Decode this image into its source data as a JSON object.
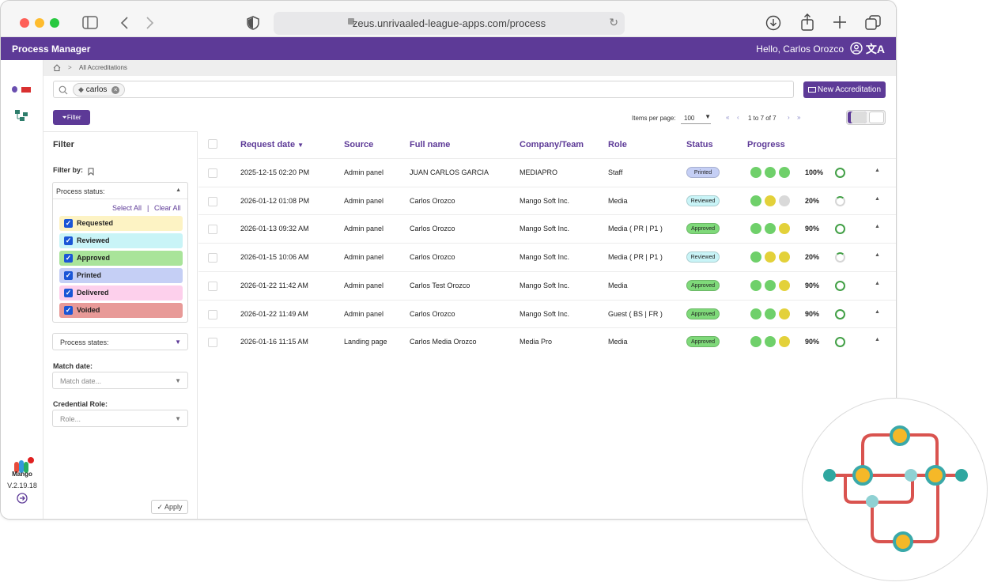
{
  "browser": {
    "url": "zeus.unrivaaled-league-apps.com/process"
  },
  "app": {
    "title": "Process Manager",
    "greeting": "Hello, Carlos Orozco"
  },
  "breadcrumb": {
    "current": "All Accreditations"
  },
  "search": {
    "chip": "carlos"
  },
  "toolbar": {
    "new_button": "New Accreditation",
    "filter_button": "Filter"
  },
  "pager": {
    "items_per_page_label": "Items per page:",
    "items_per_page": "100",
    "range": "1 to 7 of 7"
  },
  "sidebar": {
    "brand": "Mango",
    "version": "V.2.19.18"
  },
  "filter": {
    "title": "Filter",
    "filter_by": "Filter by:",
    "process_status_label": "Process status:",
    "select_all": "Select All",
    "separator": "|",
    "clear_all": "Clear All",
    "statuses": [
      {
        "label": "Requested",
        "color": "#fdf3c4"
      },
      {
        "label": "Reviewed",
        "color": "#c9f4f7"
      },
      {
        "label": "Approved",
        "color": "#a9e49a"
      },
      {
        "label": "Printed",
        "color": "#c5cff5"
      },
      {
        "label": "Delivered",
        "color": "#fdd0ec"
      },
      {
        "label": "Voided",
        "color": "#e89a98"
      }
    ],
    "process_states_label": "Process states:",
    "match_date_label": "Match date:",
    "match_date_placeholder": "Match date...",
    "credential_role_label": "Credential Role:",
    "role_placeholder": "Role...",
    "apply": "Apply"
  },
  "table": {
    "headers": {
      "request_date": "Request date",
      "source": "Source",
      "full_name": "Full name",
      "company": "Company/Team",
      "role": "Role",
      "status": "Status",
      "progress": "Progress"
    },
    "rows": [
      {
        "date": "2025-12-15 02:20 PM",
        "source": "Admin panel",
        "name": "JUAN CARLOS GARCIA",
        "company": "MEDIAPRO",
        "role": "Staff",
        "status": "Printed",
        "status_color": "#c5cff5",
        "dots": [
          "#6fd06a",
          "#6fd06a",
          "#6fd06a"
        ],
        "progress": "100%",
        "progress_value": 100
      },
      {
        "date": "2026-01-12 01:08 PM",
        "source": "Admin panel",
        "name": "Carlos Orozco",
        "company": "Mango Soft Inc.",
        "role": "Media",
        "status": "Reviewed",
        "status_color": "#c9f4f7",
        "dots": [
          "#6fd06a",
          "#e3d13a",
          "#d9d9d9"
        ],
        "progress": "20%",
        "progress_value": 20
      },
      {
        "date": "2026-01-13 09:32 AM",
        "source": "Admin panel",
        "name": "Carlos Orozco",
        "company": "Mango Soft Inc.",
        "role": "Media ( PR | P1 )",
        "status": "Approved",
        "status_color": "#7fd97a",
        "dots": [
          "#6fd06a",
          "#6fd06a",
          "#e3d13a"
        ],
        "progress": "90%",
        "progress_value": 90
      },
      {
        "date": "2026-01-15 10:06 AM",
        "source": "Admin panel",
        "name": "Carlos Orozco",
        "company": "Mango Soft Inc.",
        "role": "Media ( PR | P1 )",
        "status": "Reviewed",
        "status_color": "#c9f4f7",
        "dots": [
          "#6fd06a",
          "#e3d13a",
          "#e3d13a"
        ],
        "progress": "20%",
        "progress_value": 20
      },
      {
        "date": "2026-01-22 11:42 AM",
        "source": "Admin panel",
        "name": "Carlos Test Orozco",
        "company": "Mango Soft Inc.",
        "role": "Media",
        "status": "Approved",
        "status_color": "#7fd97a",
        "dots": [
          "#6fd06a",
          "#6fd06a",
          "#e3d13a"
        ],
        "progress": "90%",
        "progress_value": 90
      },
      {
        "date": "2026-01-22 11:49 AM",
        "source": "Admin panel",
        "name": "Carlos Orozco",
        "company": "Mango Soft Inc.",
        "role": "Guest ( BS | FR )",
        "status": "Approved",
        "status_color": "#7fd97a",
        "dots": [
          "#6fd06a",
          "#6fd06a",
          "#e3d13a"
        ],
        "progress": "90%",
        "progress_value": 90
      },
      {
        "date": "2026-01-16 11:15 AM",
        "source": "Landing page",
        "name": "Carlos Media Orozco",
        "company": "Media Pro",
        "role": "Media",
        "status": "Approved",
        "status_color": "#7fd97a",
        "dots": [
          "#6fd06a",
          "#6fd06a",
          "#e3d13a"
        ],
        "progress": "90%",
        "progress_value": 90
      }
    ]
  }
}
